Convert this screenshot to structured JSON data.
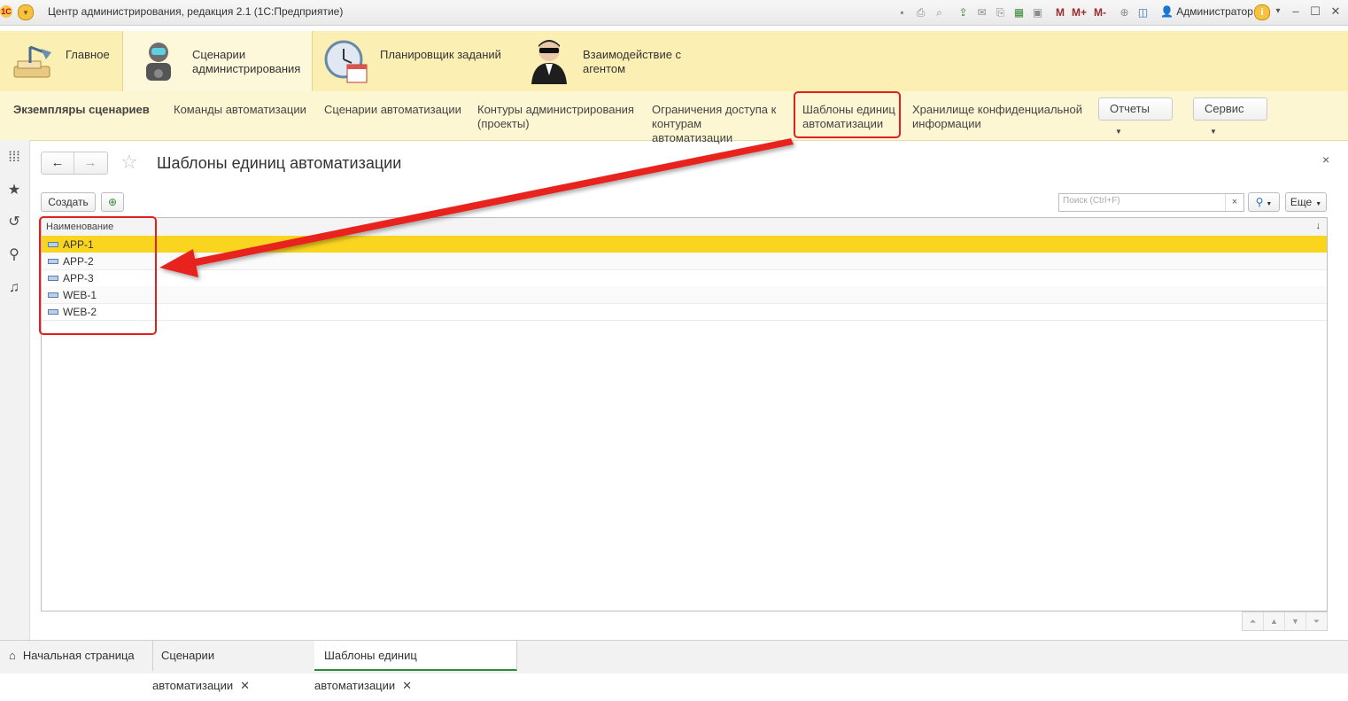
{
  "titlebar": {
    "title": "Центр администрирования, редакция 2.1  (1С:Предприятие)",
    "logo": "1С",
    "user": "Администратор",
    "m_buttons": [
      "M",
      "M+",
      "M-"
    ],
    "minimize": "–",
    "maximize": "☐",
    "close": "✕"
  },
  "sections": [
    {
      "label": "Главное",
      "icon": "desk-lamp-icon"
    },
    {
      "label": "Сценарии администрирования",
      "icon": "robot-icon"
    },
    {
      "label": "Планировщик заданий",
      "icon": "clock-calendar-icon"
    },
    {
      "label": "Взаимодействие с агентом",
      "icon": "agent-icon"
    }
  ],
  "function_panel": {
    "items": [
      "Экземпляры сценариев",
      "Команды автоматизации",
      "Сценарии автоматизации",
      "Контуры администрирования (проекты)",
      "Ограничения доступа к контурам автоматизации",
      "Шаблоны единиц автоматизации",
      "Хранилище конфиденциальной информации"
    ],
    "reports_label": "Отчеты",
    "service_label": "Сервис"
  },
  "form": {
    "title": "Шаблоны единиц автоматизации",
    "create_label": "Создать",
    "search_placeholder": "Поиск (Ctrl+F)",
    "more_label": "Еще",
    "close": "×"
  },
  "table": {
    "column": "Наименование",
    "rows": [
      "APP-1",
      "APP-2",
      "APP-3",
      "WEB-1",
      "WEB-2"
    ],
    "selected_index": 0
  },
  "bottom_tabs": [
    {
      "label": "Начальная страница"
    },
    {
      "label": "Сценарии автоматизации"
    },
    {
      "label": "Шаблоны единиц автоматизации"
    }
  ],
  "colors": {
    "sections_bg": "#fbefb4",
    "selected_row": "#f9d520",
    "annotation_red": "#e02020"
  }
}
